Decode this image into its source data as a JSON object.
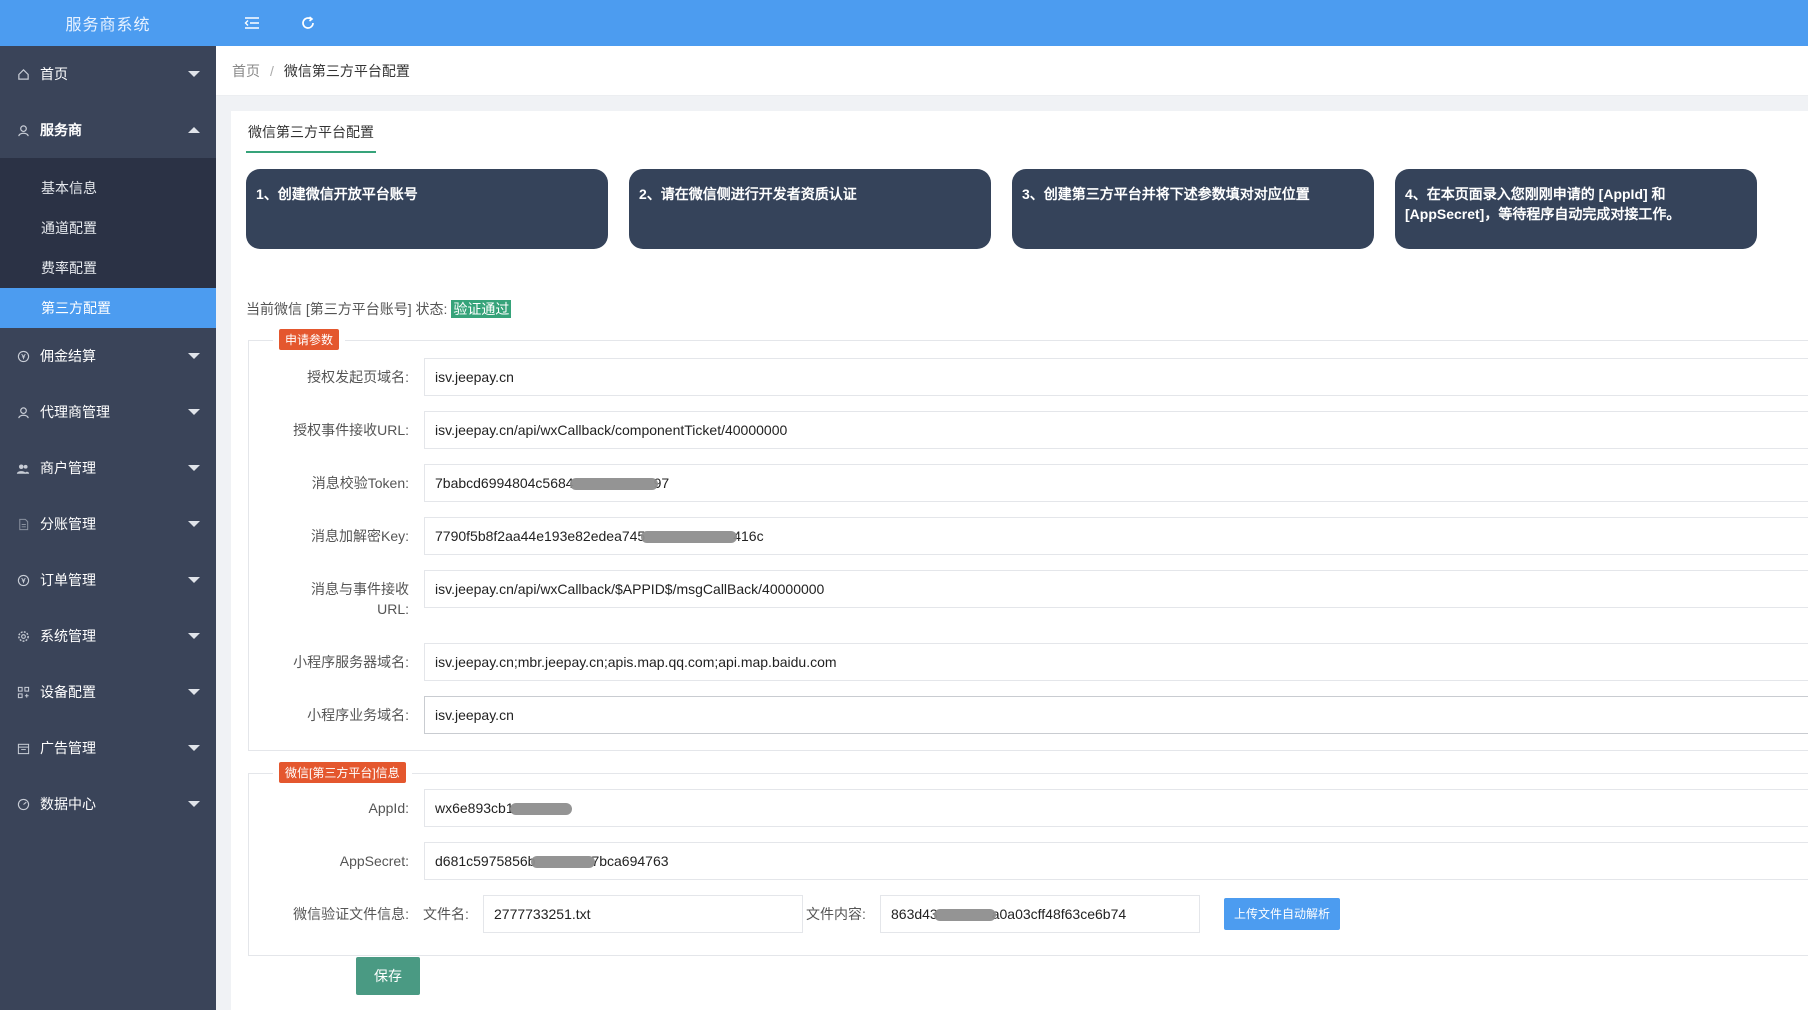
{
  "app": {
    "title": "服务商系统"
  },
  "sidebar": {
    "items": [
      {
        "label": "首页",
        "icon": "home-icon",
        "expanded": false
      },
      {
        "label": "服务商",
        "icon": "user-icon",
        "expanded": true,
        "children": [
          {
            "label": "基本信息",
            "active": false
          },
          {
            "label": "通道配置",
            "active": false
          },
          {
            "label": "费率配置",
            "active": false
          },
          {
            "label": "第三方配置",
            "active": true
          }
        ]
      },
      {
        "label": "佣金结算",
        "icon": "yen-icon",
        "expanded": false
      },
      {
        "label": "代理商管理",
        "icon": "user-icon",
        "expanded": false
      },
      {
        "label": "商户管理",
        "icon": "team-icon",
        "expanded": false
      },
      {
        "label": "分账管理",
        "icon": "file-icon",
        "expanded": false
      },
      {
        "label": "订单管理",
        "icon": "yen-icon",
        "expanded": false
      },
      {
        "label": "系统管理",
        "icon": "gear-icon",
        "expanded": false
      },
      {
        "label": "设备配置",
        "icon": "apps-icon",
        "expanded": false
      },
      {
        "label": "广告管理",
        "icon": "calendar-icon",
        "expanded": false
      },
      {
        "label": "数据中心",
        "icon": "dashboard-icon",
        "expanded": false
      }
    ]
  },
  "breadcrumb": {
    "home": "首页",
    "separator": "/",
    "current": "微信第三方平台配置"
  },
  "tab": {
    "label": "微信第三方平台配置"
  },
  "steps": [
    "1、创建微信开放平台账号",
    "2、请在微信侧进行开发者资质认证",
    "3、创建第三方平台并将下述参数填对对应位置",
    "4、在本页面录入您刚刚申请的 [AppId] 和 [AppSecret]，等待程序自动完成对接工作。"
  ],
  "status": {
    "prefix": "当前微信 [第三方平台账号] 状态: ",
    "value": "验证通过"
  },
  "apply_params": {
    "legend": "申请参数",
    "fields": [
      {
        "label": "授权发起页域名:",
        "value": "isv.jeepay.cn"
      },
      {
        "label": "授权事件接收URL:",
        "value": "isv.jeepay.cn/api/wxCallback/componentTicket/40000000"
      },
      {
        "label": "消息校验Token:",
        "value_start": "7babcd6994804c5684",
        "value_end": "97"
      },
      {
        "label": "消息加解密Key:",
        "value_start": "7790f5b8f2aa44e193e82edea745",
        "value_end": "416c"
      },
      {
        "label_line1": "消息与事件接收",
        "label_line2": "URL:",
        "value": "isv.jeepay.cn/api/wxCallback/$APPID$/msgCallBack/40000000"
      },
      {
        "label": "小程序服务器域名:",
        "value": "isv.jeepay.cn;mbr.jeepay.cn;apis.map.qq.com;api.map.baidu.com"
      },
      {
        "label": "小程序业务域名:",
        "value": "isv.jeepay.cn"
      }
    ]
  },
  "platform_info": {
    "legend": "微信[第三方平台]信息",
    "appid": {
      "label": "AppId:",
      "value_start": "wx6e893cb1",
      "value_end": ""
    },
    "appsecret": {
      "label": "AppSecret:",
      "value_start": "d681c5975856b",
      "value_end": "7bca694763"
    },
    "verify_file": {
      "label": "微信验证文件信息:",
      "filename_label": "文件名:",
      "filename": "2777733251.txt",
      "content_label": "文件内容:",
      "content_start": "863d43",
      "content_end": "a0a03cff48f63ce6b74",
      "upload_label": "上传文件自动解析"
    }
  },
  "actions": {
    "save_label": "保存"
  },
  "colors": {
    "primary": "#4c9cf0",
    "sidebar": "#3a4459",
    "success": "#36a37a",
    "legend": "#e4572e"
  }
}
